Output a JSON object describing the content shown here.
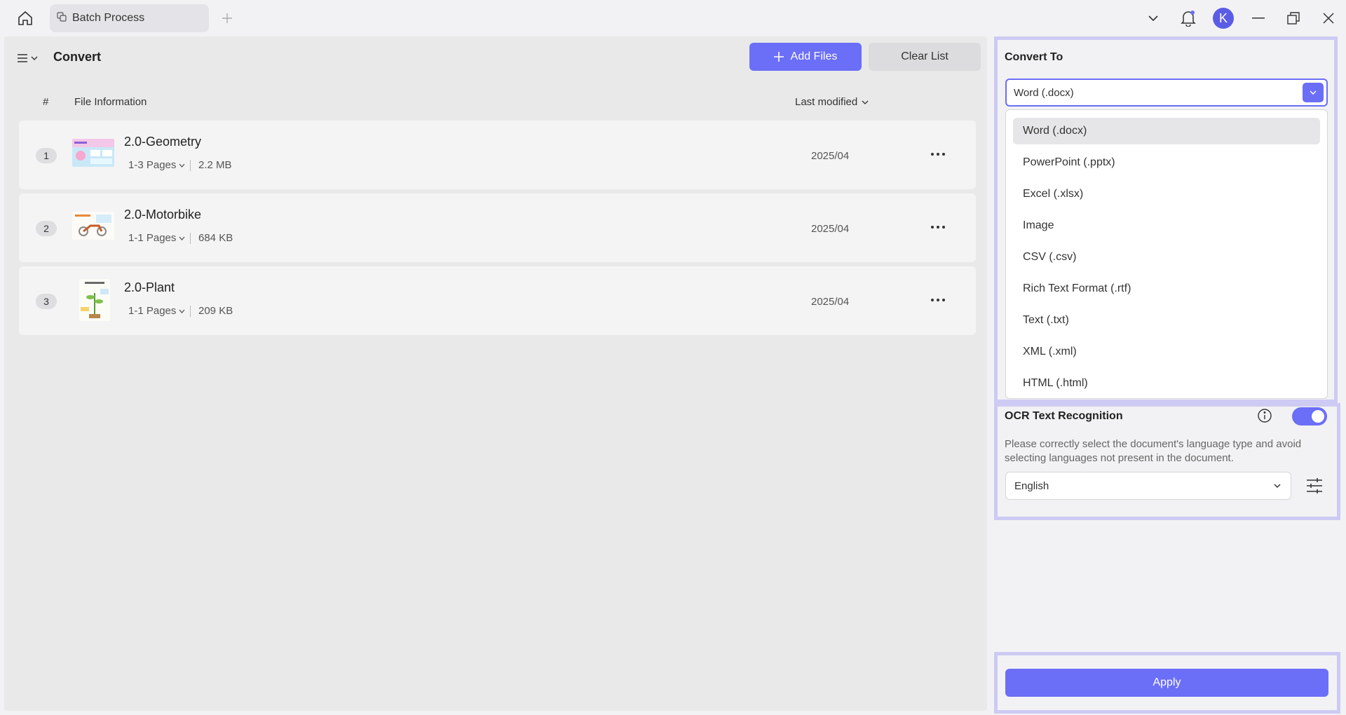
{
  "titlebar": {
    "tab_label": "Batch Process",
    "avatar_initial": "K"
  },
  "left": {
    "title": "Convert",
    "add_files_label": "Add Files",
    "clear_list_label": "Clear List",
    "columns": {
      "num": "#",
      "info": "File Information",
      "modified": "Last modified"
    },
    "files": [
      {
        "num": "1",
        "name": "2.0-Geometry",
        "pages": "1-3 Pages",
        "size": "2.2 MB",
        "date": "2025/04"
      },
      {
        "num": "2",
        "name": "2.0-Motorbike",
        "pages": "1-1 Pages",
        "size": "684 KB",
        "date": "2025/04"
      },
      {
        "num": "3",
        "name": "2.0-Plant",
        "pages": "1-1 Pages",
        "size": "209 KB",
        "date": "2025/04"
      }
    ]
  },
  "right": {
    "convert_to_label": "Convert To",
    "selected_format": "Word (.docx)",
    "formats": [
      "Word (.docx)",
      "PowerPoint (.pptx)",
      "Excel (.xlsx)",
      "Image",
      "CSV (.csv)",
      "Rich Text Format (.rtf)",
      "Text (.txt)",
      "XML (.xml)",
      "HTML (.html)"
    ],
    "ocr_label": "OCR Text Recognition",
    "ocr_enabled": true,
    "ocr_description": "Please correctly select the document's language type and avoid selecting languages not present in the document.",
    "language": "English",
    "apply_label": "Apply"
  },
  "colors": {
    "accent": "#6b6ef7",
    "outline": "#cdcbf3"
  }
}
